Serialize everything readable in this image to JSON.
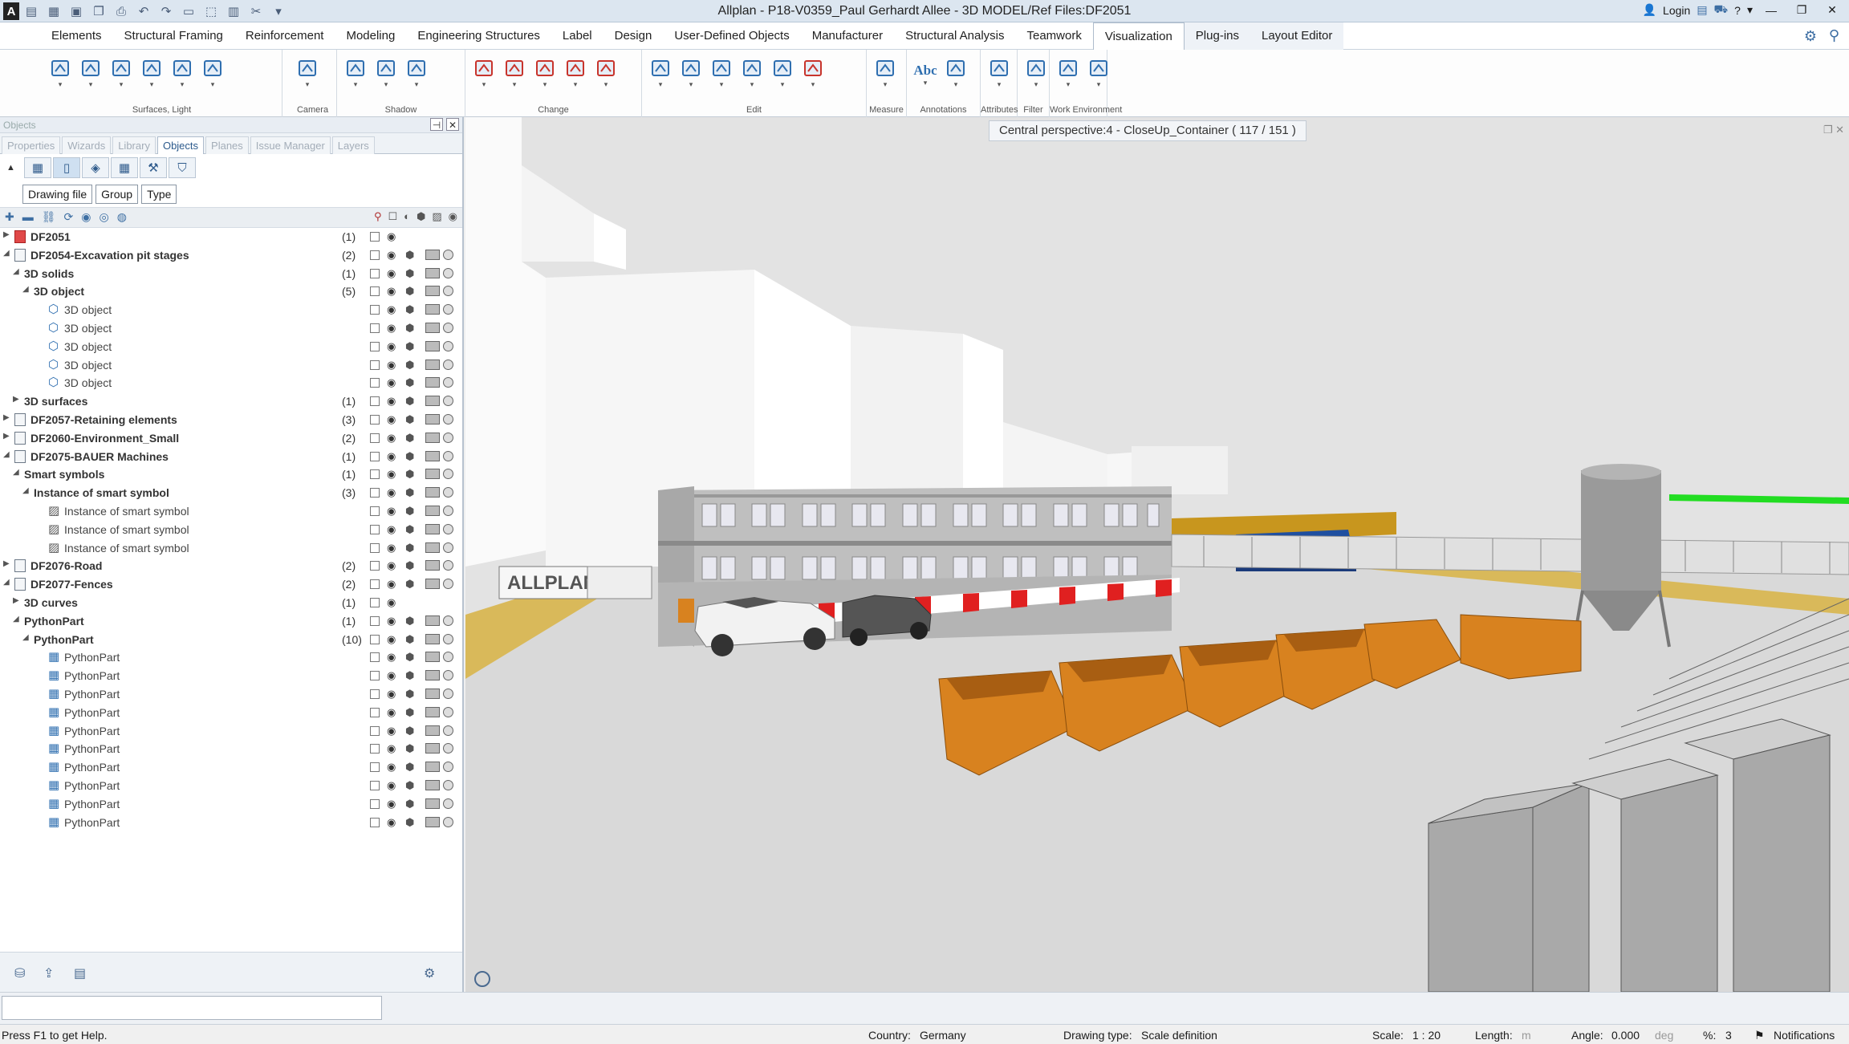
{
  "window": {
    "title": "Allplan - P18-V0359_Paul Gerhardt Allee - 3D MODEL/Ref Files:DF2051",
    "login": "Login"
  },
  "menu": [
    "Elements",
    "Structural Framing",
    "Reinforcement",
    "Modeling",
    "Engineering Structures",
    "Label",
    "Design",
    "User-Defined Objects",
    "Manufacturer",
    "Structural Analysis",
    "Teamwork",
    "Visualization",
    "Plug-ins",
    "Layout Editor"
  ],
  "menu_active": "Visualization",
  "ribbon_groups": [
    "Surfaces, Light",
    "Camera",
    "Shadow",
    "Change",
    "Edit",
    "Measure",
    "Annotations",
    "Attributes",
    "Filter",
    "Work Environment"
  ],
  "ribbon_text_icon": "Abc",
  "panel": {
    "caption": "Objects",
    "tabs": [
      "Properties",
      "Wizards",
      "Library",
      "Objects",
      "Planes",
      "Issue Manager",
      "Layers"
    ],
    "active_tab": "Objects",
    "filters": [
      "Drawing file",
      "Group",
      "Type"
    ]
  },
  "tree": [
    {
      "label": "DF2051",
      "count": "(1)",
      "level": 0,
      "exp": "▶",
      "icon": "red",
      "bold": true
    },
    {
      "label": "DF2054-Excavation pit stages",
      "count": "(2)",
      "level": 0,
      "exp": "◢",
      "icon": "file",
      "bold": true
    },
    {
      "label": "3D solids",
      "count": "(1)",
      "level": 1,
      "exp": "◢",
      "icon": "none",
      "bold": true
    },
    {
      "label": "3D object",
      "count": "(5)",
      "level": 2,
      "exp": "◢",
      "icon": "none",
      "bold": true
    },
    {
      "label": "3D object",
      "count": "",
      "level": 3,
      "exp": "",
      "icon": "obj",
      "bold": false
    },
    {
      "label": "3D object",
      "count": "",
      "level": 3,
      "exp": "",
      "icon": "obj",
      "bold": false
    },
    {
      "label": "3D object",
      "count": "",
      "level": 3,
      "exp": "",
      "icon": "obj",
      "bold": false
    },
    {
      "label": "3D object",
      "count": "",
      "level": 3,
      "exp": "",
      "icon": "obj",
      "bold": false
    },
    {
      "label": "3D object",
      "count": "",
      "level": 3,
      "exp": "",
      "icon": "obj",
      "bold": false
    },
    {
      "label": "3D surfaces",
      "count": "(1)",
      "level": 1,
      "exp": "▶",
      "icon": "none",
      "bold": true
    },
    {
      "label": "DF2057-Retaining elements",
      "count": "(3)",
      "level": 0,
      "exp": "▶",
      "icon": "file",
      "bold": true
    },
    {
      "label": "DF2060-Environment_Small",
      "count": "(2)",
      "level": 0,
      "exp": "▶",
      "icon": "file",
      "bold": true
    },
    {
      "label": "DF2075-BAUER Machines",
      "count": "(1)",
      "level": 0,
      "exp": "◢",
      "icon": "file",
      "bold": true
    },
    {
      "label": "Smart symbols",
      "count": "(1)",
      "level": 1,
      "exp": "◢",
      "icon": "none",
      "bold": true
    },
    {
      "label": "Instance of smart symbol",
      "count": "(3)",
      "level": 2,
      "exp": "◢",
      "icon": "none",
      "bold": true
    },
    {
      "label": "Instance of smart symbol",
      "count": "",
      "level": 3,
      "exp": "",
      "icon": "sym",
      "bold": false
    },
    {
      "label": "Instance of smart symbol",
      "count": "",
      "level": 3,
      "exp": "",
      "icon": "sym",
      "bold": false
    },
    {
      "label": "Instance of smart symbol",
      "count": "",
      "level": 3,
      "exp": "",
      "icon": "sym",
      "bold": false
    },
    {
      "label": "DF2076-Road",
      "count": "(2)",
      "level": 0,
      "exp": "▶",
      "icon": "file",
      "bold": true
    },
    {
      "label": "DF2077-Fences",
      "count": "(2)",
      "level": 0,
      "exp": "◢",
      "icon": "file",
      "bold": true
    },
    {
      "label": "3D curves",
      "count": "(1)",
      "level": 1,
      "exp": "▶",
      "icon": "none",
      "bold": true
    },
    {
      "label": "PythonPart",
      "count": "(1)",
      "level": 1,
      "exp": "◢",
      "icon": "none",
      "bold": true
    },
    {
      "label": "PythonPart",
      "count": "(10)",
      "level": 2,
      "exp": "◢",
      "icon": "none",
      "bold": true
    },
    {
      "label": "PythonPart",
      "count": "",
      "level": 3,
      "exp": "",
      "icon": "py",
      "bold": false
    },
    {
      "label": "PythonPart",
      "count": "",
      "level": 3,
      "exp": "",
      "icon": "py",
      "bold": false
    },
    {
      "label": "PythonPart",
      "count": "",
      "level": 3,
      "exp": "",
      "icon": "py",
      "bold": false
    },
    {
      "label": "PythonPart",
      "count": "",
      "level": 3,
      "exp": "",
      "icon": "py",
      "bold": false
    },
    {
      "label": "PythonPart",
      "count": "",
      "level": 3,
      "exp": "",
      "icon": "py",
      "bold": false
    },
    {
      "label": "PythonPart",
      "count": "",
      "level": 3,
      "exp": "",
      "icon": "py",
      "bold": false
    },
    {
      "label": "PythonPart",
      "count": "",
      "level": 3,
      "exp": "",
      "icon": "py",
      "bold": false
    },
    {
      "label": "PythonPart",
      "count": "",
      "level": 3,
      "exp": "",
      "icon": "py",
      "bold": false
    },
    {
      "label": "PythonPart",
      "count": "",
      "level": 3,
      "exp": "",
      "icon": "py",
      "bold": false
    },
    {
      "label": "PythonPart",
      "count": "",
      "level": 3,
      "exp": "",
      "icon": "py",
      "bold": false
    }
  ],
  "viewport": {
    "title": "Central perspective:4 - CloseUp_Container ( 117 / 151 )",
    "sign_text": "ALLPLAN"
  },
  "status": {
    "help": "Press F1 to get Help.",
    "country_label": "Country:",
    "country": "Germany",
    "drawing_type_label": "Drawing type:",
    "drawing_type": "Scale definition",
    "scale_label": "Scale:",
    "scale": "1 : 20",
    "length_label": "Length:",
    "length_unit": "m",
    "angle_label": "Angle:",
    "angle": "0.000",
    "angle_unit": "deg",
    "percent_label": "%:",
    "percent": "3",
    "notifications": "Notifications"
  },
  "colors": {
    "accent": "#2c5a8c",
    "container": "#d8821f",
    "ground": "#d9d9d9",
    "sky": "#e4e4e4"
  }
}
